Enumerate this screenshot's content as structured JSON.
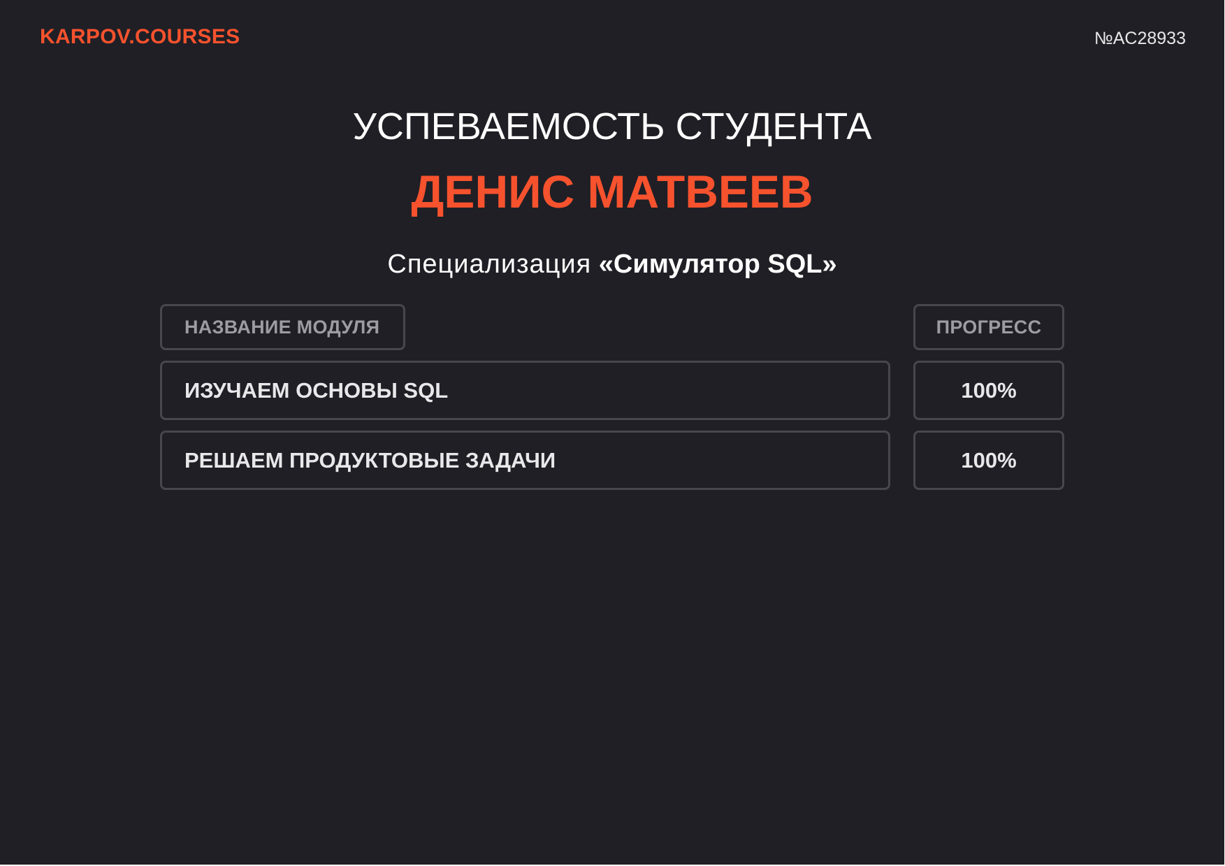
{
  "header": {
    "brand": "KARPOV.COURSES",
    "certificate_number": "№AC28933"
  },
  "title": {
    "heading": "УСПЕВАЕМОСТЬ СТУДЕНТА",
    "student_name": "ДЕНИС МАТВЕЕВ"
  },
  "specialization": {
    "label": "Специализация",
    "name": "«Симулятор SQL»"
  },
  "table": {
    "columns": {
      "module": "НАЗВАНИЕ МОДУЛЯ",
      "progress": "ПРОГРЕСС"
    },
    "rows": [
      {
        "module": "ИЗУЧАЕМ ОСНОВЫ SQL",
        "progress": "100%"
      },
      {
        "module": "РЕШАЕМ ПРОДУКТОВЫЕ ЗАДАЧИ",
        "progress": "100%"
      }
    ]
  },
  "colors": {
    "background": "#1f1f25",
    "accent": "#f6522e",
    "border": "#47474d",
    "muted_text": "#9c9ca2",
    "text": "#e8e8ea"
  }
}
